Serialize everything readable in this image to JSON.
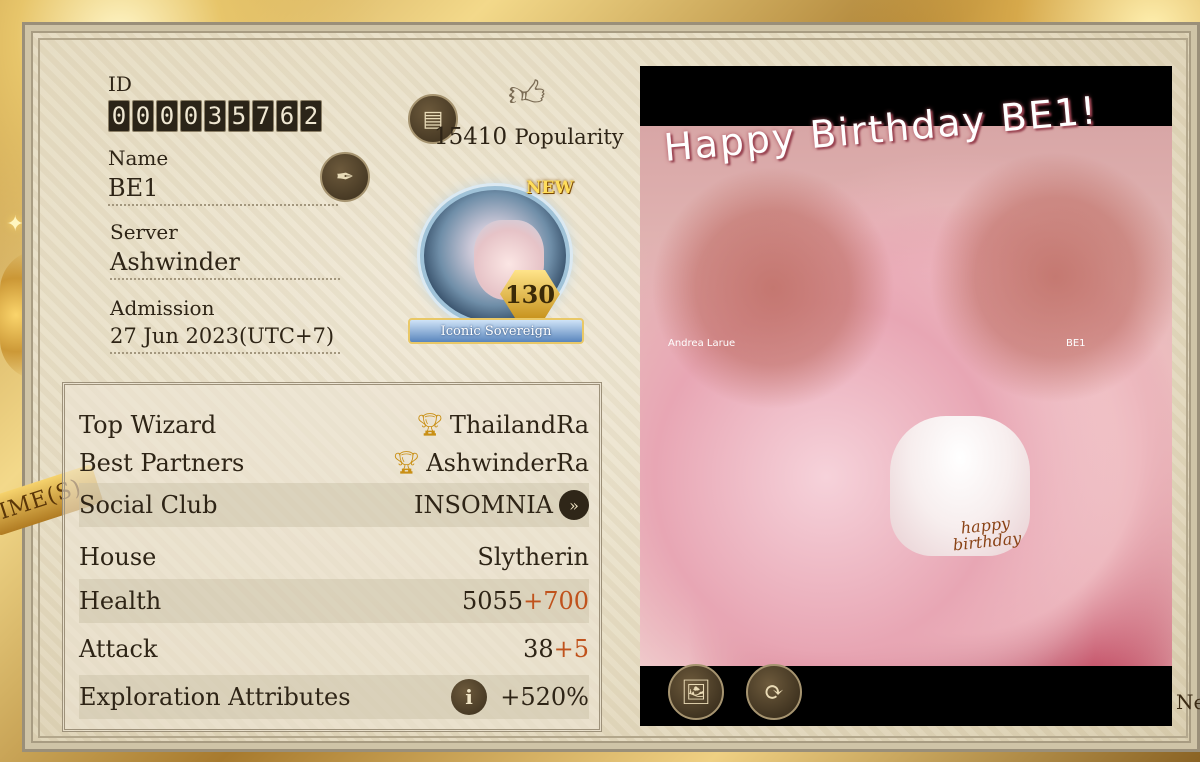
{
  "profile": {
    "id_label": "ID",
    "id_digits": [
      "0",
      "0",
      "0",
      "0",
      "3",
      "5",
      "7",
      "6",
      "2"
    ],
    "popularity_value": "15410",
    "popularity_label": "Popularity",
    "name_label": "Name",
    "name_value": "BE1",
    "server_label": "Server",
    "server_value": "Ashwinder",
    "admission_label": "Admission",
    "admission_value": "27 Jun 2023(UTC+7)"
  },
  "avatar": {
    "new_badge": "NEW",
    "level": "130",
    "title": "Iconic Sovereign"
  },
  "stats": {
    "top_wizard_label": "Top Wizard",
    "top_wizard_value": "ThailandRa",
    "best_partners_label": "Best Partners",
    "best_partners_value": "AshwinderRa",
    "social_club_label": "Social Club",
    "social_club_value": "INSOMNIA",
    "house_label": "House",
    "house_value": "Slytherin",
    "health_label": "Health",
    "health_base": "5055",
    "health_bonus": "+700",
    "attack_label": "Attack",
    "attack_base": "38",
    "attack_bonus": "+5",
    "exploration_label": "Exploration Attributes",
    "exploration_value": "+520%"
  },
  "image": {
    "caption": "Happy Birthday BE1!",
    "artist_left": "Andrea Larue",
    "artist_right": "BE1",
    "cake_line1": "happy",
    "cake_line2": "birthday"
  },
  "decor": {
    "ribbon_text": "IME(S)",
    "edge_text": "Ne"
  },
  "icons": {
    "copy": "copy-icon",
    "edit": "quill-icon",
    "popularity": "thumbs-up-icon",
    "trophy": "trophy-icon",
    "chevron": "double-chevron-right-icon",
    "info": "info-icon",
    "gallery": "gallery-edit-icon",
    "refresh": "refresh-icon"
  },
  "colors": {
    "bonus": "#c0521c",
    "parchment": "#e6dcc2",
    "gold": "#c8941f"
  }
}
